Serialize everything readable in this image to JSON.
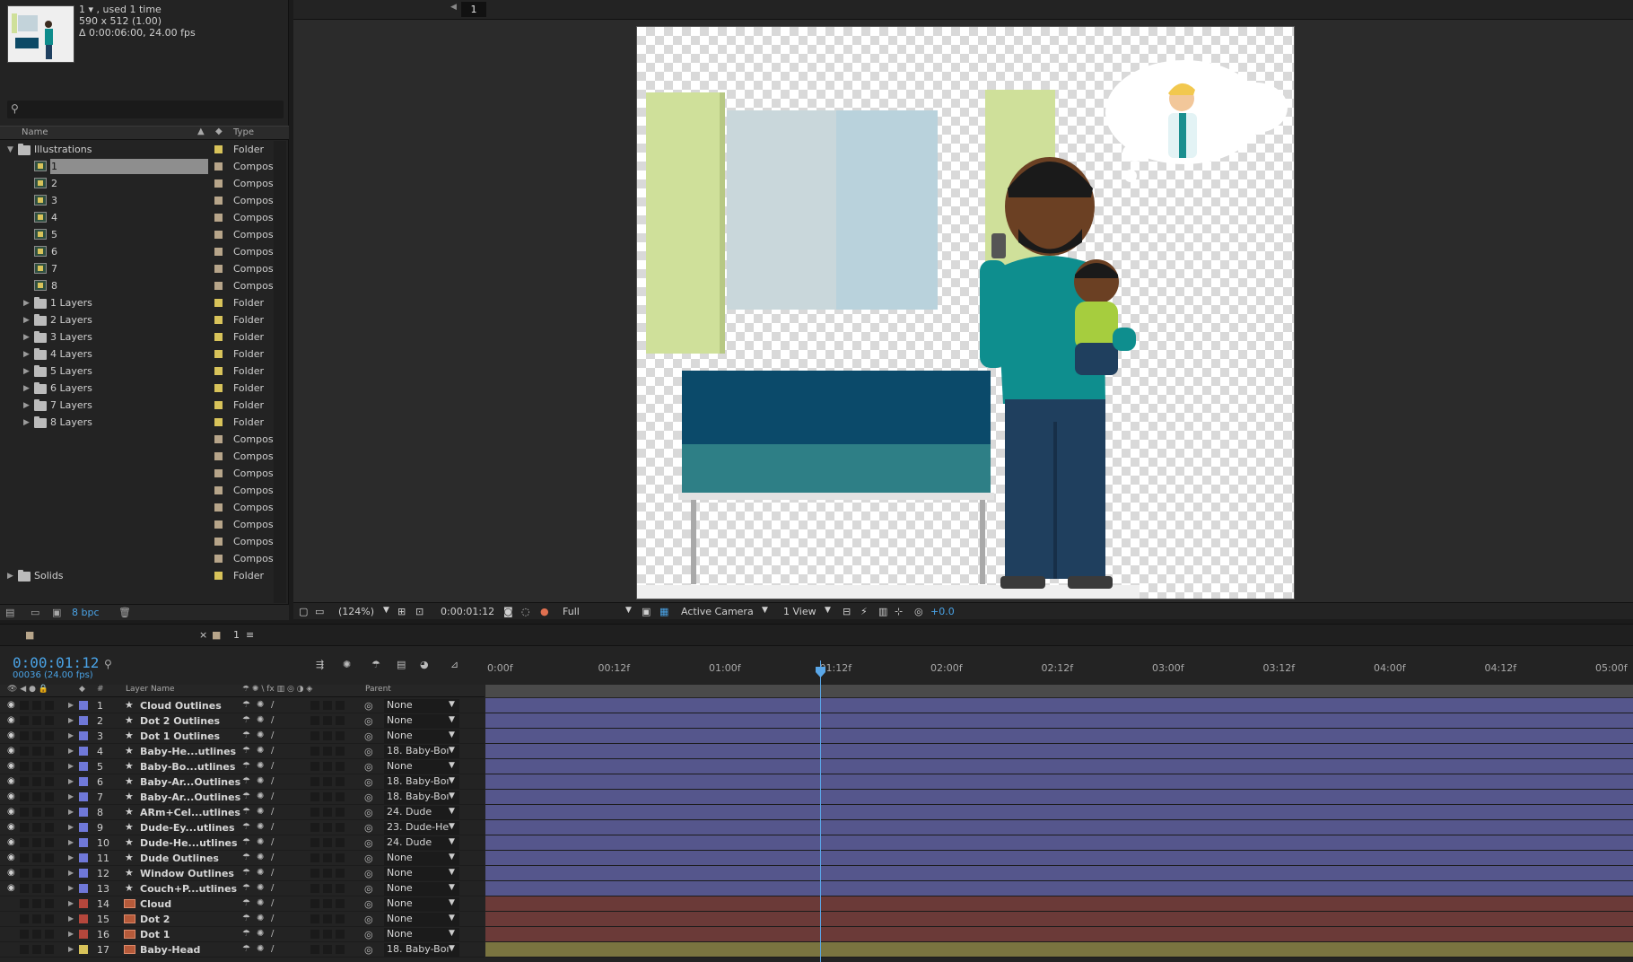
{
  "project": {
    "meta": {
      "line1": "1 ▾ , used 1 time",
      "line2": "590 x 512 (1.00)",
      "line3": "Δ 0:00:06:00, 24.00 fps"
    },
    "columns": {
      "name": "Name",
      "type": "Type"
    },
    "items": [
      {
        "name": "Illustrations",
        "type": "Folder",
        "kind": "folder",
        "depth": 0,
        "open": true
      },
      {
        "name": "1",
        "type": "Compos",
        "kind": "comp",
        "depth": 1,
        "selected": true
      },
      {
        "name": "2",
        "type": "Compos",
        "kind": "comp",
        "depth": 1
      },
      {
        "name": "3",
        "type": "Compos",
        "kind": "comp",
        "depth": 1
      },
      {
        "name": "4",
        "type": "Compos",
        "kind": "comp",
        "depth": 1
      },
      {
        "name": "5",
        "type": "Compos",
        "kind": "comp",
        "depth": 1
      },
      {
        "name": "6",
        "type": "Compos",
        "kind": "comp",
        "depth": 1
      },
      {
        "name": "7",
        "type": "Compos",
        "kind": "comp",
        "depth": 1
      },
      {
        "name": "8",
        "type": "Compos",
        "kind": "comp",
        "depth": 1
      },
      {
        "name": "1 Layers",
        "type": "Folder",
        "kind": "folder",
        "depth": 1
      },
      {
        "name": "2 Layers",
        "type": "Folder",
        "kind": "folder",
        "depth": 1
      },
      {
        "name": "3 Layers",
        "type": "Folder",
        "kind": "folder",
        "depth": 1
      },
      {
        "name": "4 Layers",
        "type": "Folder",
        "kind": "folder",
        "depth": 1
      },
      {
        "name": "5 Layers",
        "type": "Folder",
        "kind": "folder",
        "depth": 1
      },
      {
        "name": "6 Layers",
        "type": "Folder",
        "kind": "folder",
        "depth": 1
      },
      {
        "name": "7 Layers",
        "type": "Folder",
        "kind": "folder",
        "depth": 1
      },
      {
        "name": "8 Layers",
        "type": "Folder",
        "kind": "folder",
        "depth": 1
      },
      {
        "name": "",
        "type": "Compos",
        "kind": "blank"
      },
      {
        "name": "",
        "type": "Compos",
        "kind": "blank"
      },
      {
        "name": "",
        "type": "Compos",
        "kind": "blank"
      },
      {
        "name": "",
        "type": "Compos",
        "kind": "blank"
      },
      {
        "name": "",
        "type": "Compos",
        "kind": "blank"
      },
      {
        "name": "",
        "type": "Compos",
        "kind": "blank"
      },
      {
        "name": "",
        "type": "Compos",
        "kind": "blank"
      },
      {
        "name": "",
        "type": "Compos",
        "kind": "blank"
      },
      {
        "name": "Solids",
        "type": "Folder",
        "kind": "folder",
        "depth": 0
      }
    ],
    "bpc": "8 bpc"
  },
  "viewer": {
    "tab": "1",
    "zoom": "(124%)",
    "timecode": "0:00:01:12",
    "resolution": "Full",
    "camera": "Active Camera",
    "views": "1 View",
    "exposure": "+0.0"
  },
  "timeline": {
    "tab": "1",
    "timecode": "0:00:01:12",
    "frames": "00036 (24.00 fps)",
    "columns": {
      "num": "#",
      "layer_name": "Layer Name",
      "parent": "Parent"
    },
    "ruler": [
      "0:00f",
      "00:12f",
      "01:00f",
      "01:12f",
      "02:00f",
      "02:12f",
      "03:00f",
      "03:12f",
      "04:00f",
      "04:12f",
      "05:00f"
    ],
    "layers": [
      {
        "num": "1",
        "name": "Cloud Outlines",
        "parent": "None",
        "color": "#6f78d8",
        "kind": "shape",
        "visible": true
      },
      {
        "num": "2",
        "name": "Dot 2 Outlines",
        "parent": "None",
        "color": "#6f78d8",
        "kind": "shape",
        "visible": true
      },
      {
        "num": "3",
        "name": "Dot 1 Outlines",
        "parent": "None",
        "color": "#6f78d8",
        "kind": "shape",
        "visible": true
      },
      {
        "num": "4",
        "name": "Baby-He...utlines",
        "parent": "18. Baby-Boı",
        "color": "#6f78d8",
        "kind": "shape",
        "visible": true
      },
      {
        "num": "5",
        "name": "Baby-Bo...utlines",
        "parent": "None",
        "color": "#6f78d8",
        "kind": "shape",
        "visible": true
      },
      {
        "num": "6",
        "name": "Baby-Ar...Outlines",
        "parent": "18. Baby-Boı",
        "color": "#6f78d8",
        "kind": "shape",
        "visible": true
      },
      {
        "num": "7",
        "name": "Baby-Ar...Outlines",
        "parent": "18. Baby-Boı",
        "color": "#6f78d8",
        "kind": "shape",
        "visible": true
      },
      {
        "num": "8",
        "name": "ARm+Cel...utlines",
        "parent": "24. Dude",
        "color": "#6f78d8",
        "kind": "shape",
        "visible": true
      },
      {
        "num": "9",
        "name": "Dude-Ey...utlines",
        "parent": "23. Dude-He",
        "color": "#6f78d8",
        "kind": "shape",
        "visible": true
      },
      {
        "num": "10",
        "name": "Dude-He...utlines",
        "parent": "24. Dude",
        "color": "#6f78d8",
        "kind": "shape",
        "visible": true
      },
      {
        "num": "11",
        "name": "Dude Outlines",
        "parent": "None",
        "color": "#6f78d8",
        "kind": "shape",
        "visible": true
      },
      {
        "num": "12",
        "name": "Window Outlines",
        "parent": "None",
        "color": "#6f78d8",
        "kind": "shape",
        "visible": true
      },
      {
        "num": "13",
        "name": "Couch+P...utlines",
        "parent": "None",
        "color": "#6f78d8",
        "kind": "shape",
        "visible": true
      },
      {
        "num": "14",
        "name": "Cloud",
        "parent": "None",
        "color": "#b5473c",
        "kind": "comp",
        "visible": false
      },
      {
        "num": "15",
        "name": "Dot 2",
        "parent": "None",
        "color": "#b5473c",
        "kind": "comp",
        "visible": false
      },
      {
        "num": "16",
        "name": "Dot 1",
        "parent": "None",
        "color": "#b5473c",
        "kind": "comp",
        "visible": false
      },
      {
        "num": "17",
        "name": "Baby-Head",
        "parent": "18. Baby-Boı",
        "color": "#d8c35a",
        "kind": "comp",
        "visible": false
      }
    ],
    "track_colors": {
      "shape": "#55568c",
      "comp_red": "#6b3a38",
      "comp_yellow": "#7a7440"
    },
    "current_time_fraction": 0.3
  }
}
